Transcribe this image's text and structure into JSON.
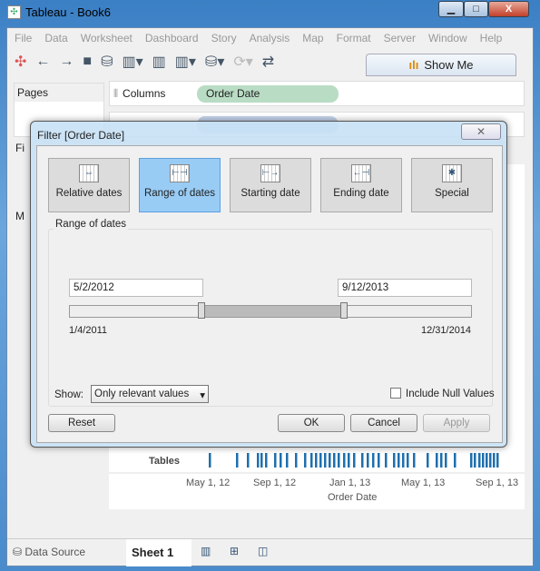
{
  "window": {
    "title": "Tableau - Book6",
    "minimize": "▁",
    "maximize": "□",
    "close": "X"
  },
  "menu": [
    "File",
    "Data",
    "Worksheet",
    "Dashboard",
    "Story",
    "Analysis",
    "Map",
    "Format",
    "Server",
    "Window",
    "Help"
  ],
  "toolbar": {
    "show_me": "Show Me"
  },
  "left": {
    "pages": "Pages",
    "filters": "Fi",
    "marks": "M"
  },
  "shelves": {
    "columns_label": "Columns",
    "columns_pill": "Order Date"
  },
  "view": {
    "row_label": "Tables",
    "x_ticks": [
      "May 1, 12",
      "Sep 1, 12",
      "Jan 1, 13",
      "May 1, 13",
      "Sep 1, 13"
    ],
    "x_title": "Order Date",
    "mark_color": "#1f6fad"
  },
  "bottom": {
    "data_source": "Data Source",
    "sheet": "Sheet 1"
  },
  "dialog": {
    "title": "Filter [Order Date]",
    "types": [
      {
        "label": "Relative dates",
        "icon": "relative-dates-icon",
        "selected": false
      },
      {
        "label": "Range of dates",
        "icon": "range-dates-icon",
        "selected": true
      },
      {
        "label": "Starting date",
        "icon": "starting-date-icon",
        "selected": false
      },
      {
        "label": "Ending date",
        "icon": "ending-date-icon",
        "selected": false
      },
      {
        "label": "Special",
        "icon": "special-icon",
        "selected": false
      }
    ],
    "group_label": "Range of dates",
    "start_value": "5/2/2012",
    "end_value": "9/12/2013",
    "min_date": "1/4/2011",
    "max_date": "12/31/2014",
    "show_label": "Show:",
    "show_value": "Only relevant values",
    "include_null": "Include Null Values",
    "include_null_checked": false,
    "reset": "Reset",
    "ok": "OK",
    "cancel": "Cancel",
    "apply": "Apply"
  }
}
